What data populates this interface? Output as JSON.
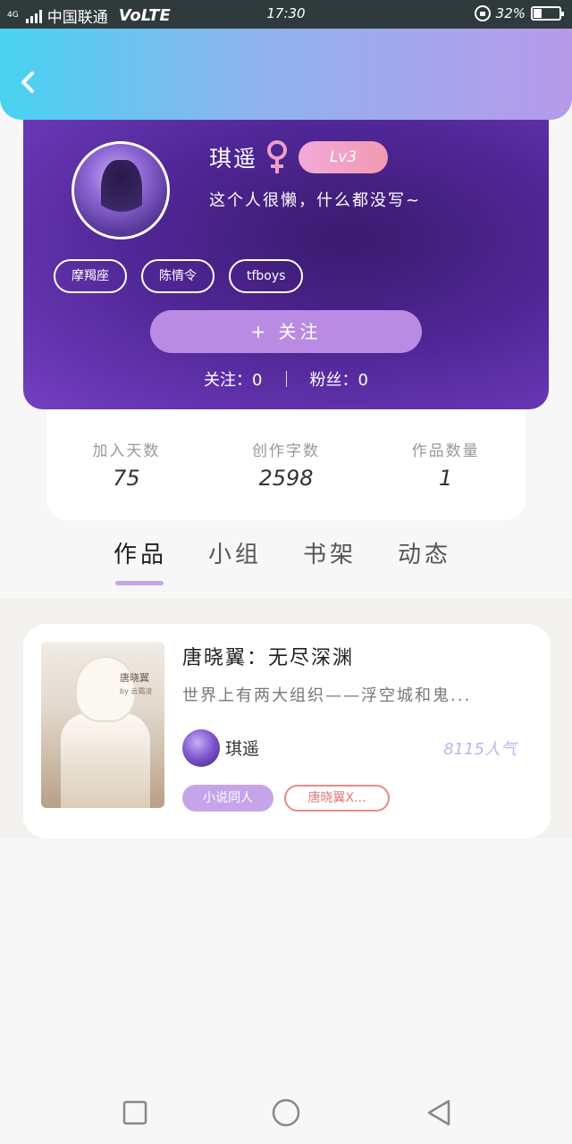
{
  "status_bar": {
    "network": "4G",
    "carrier": "中国联通",
    "volte": "VoLTE",
    "time": "17:30",
    "battery_percent": "32%",
    "battery_level": 0.32
  },
  "header": {
    "back_icon": "chevron-left-icon"
  },
  "profile": {
    "name": "琪遥",
    "gender_icon": "female-icon",
    "level": "Lv3",
    "bio": "这个人很懒，什么都没写~",
    "tags": [
      "摩羯座",
      "陈情令",
      "tfboys"
    ],
    "follow_label": "+ 关注",
    "following_label": "关注：0",
    "followers_label": "粉丝：0"
  },
  "stats": [
    {
      "label": "加入天数",
      "value": "75"
    },
    {
      "label": "创作字数",
      "value": "2598"
    },
    {
      "label": "作品数量",
      "value": "1"
    }
  ],
  "tabs": [
    {
      "label": "作品",
      "active": true
    },
    {
      "label": "小组",
      "active": false
    },
    {
      "label": "书架",
      "active": false
    },
    {
      "label": "动态",
      "active": false
    }
  ],
  "work": {
    "cover_title": "唐晓翼",
    "cover_subtitle": "by 云霜凌",
    "title": "唐晓翼：无尽深渊",
    "description": "世界上有两大组织——浮空城和鬼...",
    "author": "琪遥",
    "popularity": "8115人气",
    "tags": [
      "小说同人",
      "唐晓翼X..."
    ]
  },
  "colors": {
    "header_gradient_start": "#48d3f0",
    "header_gradient_end": "#b79ae9",
    "profile_bg": "#4f2695",
    "accent": "#c6a6ea",
    "level_badge": "#f2a9d9",
    "tag_outline_red": "#e88a8a"
  },
  "navbar": {
    "icons": [
      "square-icon",
      "circle-icon",
      "triangle-back-icon"
    ]
  }
}
